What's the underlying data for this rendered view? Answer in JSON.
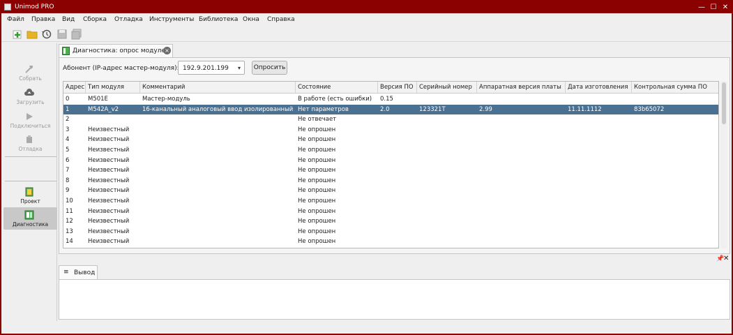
{
  "window": {
    "title": "Unimod PRO",
    "controls": {
      "minimize": "—",
      "maximize": "☐",
      "close": "✕"
    }
  },
  "menu": [
    "Файл",
    "Правка",
    "Вид",
    "Сборка",
    "Отладка",
    "Инструменты",
    "Библиотека",
    "Окна",
    "Справка"
  ],
  "toolbar": {
    "buttons": [
      {
        "name": "new-project-icon",
        "color": "#2e9e2e"
      },
      {
        "name": "open-folder-icon",
        "color": "#e6b422"
      },
      {
        "name": "history-icon",
        "color": "#555555"
      },
      {
        "name": "save-icon",
        "color": "#9e9e9e"
      },
      {
        "name": "save-all-icon",
        "color": "#9e9e9e"
      }
    ]
  },
  "left_panel": {
    "actions": [
      {
        "label": "Собрать",
        "icon": "hammer-icon",
        "enabled": false
      },
      {
        "label": "Загрузить",
        "icon": "cloud-upload-icon",
        "enabled": false
      },
      {
        "label": "Подключиться",
        "icon": "play-icon",
        "enabled": false
      },
      {
        "label": "Отладка",
        "icon": "bug-icon",
        "enabled": false
      }
    ],
    "views": [
      {
        "label": "Проект",
        "icon": "project-icon",
        "active": false
      },
      {
        "label": "Диагностика",
        "icon": "diagnostics-icon",
        "active": true
      }
    ]
  },
  "doc_tab": {
    "label": "Диагностика: опрос модулей",
    "close": "×"
  },
  "diagnostics": {
    "abonent_label": "Абонент (IP-адрес мастер-модуля):",
    "ip_value": "192.9.201.199",
    "combo_arrow": "▾",
    "poll_button": "Опросить",
    "columns": [
      "Адрес",
      "Тип модуля",
      "Комментарий",
      "Состояние",
      "Версия ПО",
      "Серийный номер",
      "Аппаратная версия платы",
      "Дата изготовления",
      "Контрольная сумма ПО"
    ],
    "rows": [
      [
        "0",
        "M501E",
        "Мастер-модуль",
        "В работе (есть ошибки)",
        "0.15",
        "",
        "",
        "",
        ""
      ],
      [
        "1",
        "M542A_v2",
        "16-канальный аналоговый ввод изолированный",
        "Нет параметров",
        "2.0",
        "123321T",
        "2.99",
        "11.11.1112",
        "83b65072"
      ],
      [
        "2",
        "",
        "",
        "Не отвечает",
        "",
        "",
        "",
        "",
        ""
      ],
      [
        "3",
        "Неизвестный",
        "",
        "Не опрошен",
        "",
        "",
        "",
        "",
        ""
      ],
      [
        "4",
        "Неизвестный",
        "",
        "Не опрошен",
        "",
        "",
        "",
        "",
        ""
      ],
      [
        "5",
        "Неизвестный",
        "",
        "Не опрошен",
        "",
        "",
        "",
        "",
        ""
      ],
      [
        "6",
        "Неизвестный",
        "",
        "Не опрошен",
        "",
        "",
        "",
        "",
        ""
      ],
      [
        "7",
        "Неизвестный",
        "",
        "Не опрошен",
        "",
        "",
        "",
        "",
        ""
      ],
      [
        "8",
        "Неизвестный",
        "",
        "Не опрошен",
        "",
        "",
        "",
        "",
        ""
      ],
      [
        "9",
        "Неизвестный",
        "",
        "Не опрошен",
        "",
        "",
        "",
        "",
        ""
      ],
      [
        "10",
        "Неизвестный",
        "",
        "Не опрошен",
        "",
        "",
        "",
        "",
        ""
      ],
      [
        "11",
        "Неизвестный",
        "",
        "Не опрошен",
        "",
        "",
        "",
        "",
        ""
      ],
      [
        "12",
        "Неизвестный",
        "",
        "Не опрошен",
        "",
        "",
        "",
        "",
        ""
      ],
      [
        "13",
        "Неизвестный",
        "",
        "Не опрошен",
        "",
        "",
        "",
        "",
        ""
      ],
      [
        "14",
        "Неизвестный",
        "",
        "Не опрошен",
        "",
        "",
        "",
        "",
        ""
      ]
    ],
    "selected_row": 1
  },
  "output_panel": {
    "tab_label": "Вывод",
    "tab_icon": "≡",
    "pin": "📌",
    "close": "✕"
  },
  "colors": {
    "title_bar": "#8b0000",
    "selection": "#4a7092"
  }
}
